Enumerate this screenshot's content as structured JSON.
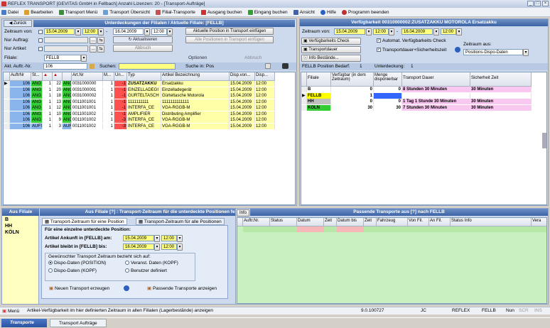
{
  "window": {
    "title": "REFLEX TRANSPORT [GEVITAS GmbH in Fellbach] Anzahl Lizenzen: 20 - [Transport-Aufträge]"
  },
  "menu": [
    {
      "label": "Datei"
    },
    {
      "label": "Bearbeiten"
    },
    {
      "label": "Transport Menü"
    },
    {
      "label": "Transport Übersicht"
    },
    {
      "label": "Filial-Transporte"
    },
    {
      "label": "Ausgang buchen"
    },
    {
      "label": "Eingang buchen"
    },
    {
      "label": "Ansicht"
    },
    {
      "label": "Hilfe"
    },
    {
      "label": "Programm beenden"
    }
  ],
  "left": {
    "back": "Zurück",
    "header": "Unterdeckungen der Filialen / Aktuelle Filiale: [FELLB]",
    "zeitraum_label": "Zeitraum von:",
    "date_from": "15.04.2009",
    "time_from": "12:00",
    "date_to": "16.04.2009",
    "time_to": "12:00",
    "nur_auftrag": "Nur Auftrag:",
    "nur_artikel": "Nur Artikel:",
    "filiale_label": "Filiale:",
    "filiale": "FELLB",
    "btn_insert": "Aktuelle Position in Transport einfügen",
    "btn_insert_all": "Alle Positionen in Transport einfügen",
    "btn_refresh": "Aktualisieren",
    "btn_cancel": "Abbruch",
    "optionen": "Optionen",
    "abbruch": "Abbruch",
    "akt_auftr": "Akt. Auftr.-Nr.",
    "akt_auftr_value": "106",
    "suchen": "Suchen:",
    "suche_in": "Suche in: Pos",
    "columns": [
      "AuftrNr",
      "St...",
      "",
      "",
      "Art.Nr",
      "M...",
      "Un...",
      "Typ",
      "Artikel Bezeichnung",
      "Disp.von...",
      "Disp..."
    ],
    "rows": [
      [
        "106",
        "ANG",
        "1",
        "22",
        "ANG",
        "0031000000",
        "1",
        "-1",
        "ZUSATZAKKU",
        "Ersatzakku",
        "15.04.2009",
        "12:00"
      ],
      [
        "106",
        "ANG",
        "1",
        "20",
        "ANG",
        "0031000001",
        "1",
        "-1",
        "EINZELLADEGI",
        "Einzelladegerät",
        "15.04.2009",
        "12:00"
      ],
      [
        "106",
        "ANG",
        "1",
        "18",
        "ANG",
        "0031000002",
        "1",
        "-1",
        "GÜRTELTASCH",
        "Gürteltasche Motorola",
        "15.04.2009",
        "12:00"
      ],
      [
        "106",
        "ANG",
        "1",
        "13",
        "ANG",
        "0011001001",
        "1",
        "-1",
        "1111111111",
        "1111111111111",
        "15.04.2009",
        "12:00"
      ],
      [
        "106",
        "ANG",
        "1",
        "12",
        "ANG",
        "0011001001",
        "1",
        "-1",
        "INTERFA_CE",
        "VGA-RGGB-M",
        "15.04.2009",
        "12:00"
      ],
      [
        "106",
        "ANG",
        "1",
        "10",
        "ANG",
        "0011001002",
        "1",
        "-1",
        "AMPLIFIER",
        "Distributing Amplifier",
        "15.04.2009",
        "12:00"
      ],
      [
        "106",
        "ANG",
        "1",
        "9",
        "ANG",
        "0011001002",
        "1",
        "-3",
        "INTERFA_CE",
        "VGA-RGGB-M",
        "15.04.2009",
        "12:00"
      ],
      [
        "106",
        "AUFT",
        "1",
        "3",
        "AUFT",
        "0011001002",
        "1",
        "-3",
        "INTERFA_CE",
        "VGA-RGGB-M",
        "15.04.2009",
        "12:00"
      ]
    ]
  },
  "right": {
    "header": "Verfügbarkeit 00310000002:ZUSATZAKKU MOTOROLA Ersatzakku",
    "zeitraum_label": "Zeitraum von:",
    "date_from": "15.04.2009",
    "time_from": "12:00",
    "date_to": "16.04.2009",
    "time_to": "12:00",
    "btn_check": "Verfügbarkeits Check",
    "btn_dauer": "Transportdauer",
    "btn_info": "Info Bestände...",
    "cb_auto": "Automat. Verfügbarkeits Check",
    "cb_sicher": "Transportdauer+Sicherheitszeit",
    "zeitraum_aus_label": "Zeitraum aus:",
    "zeitraum_aus": "Positions-Dispo-Daten",
    "pos_bedarf": "FELLB Position Bedarf:",
    "pos_bedarf_value": "1",
    "unterdeckung": "Unterdeckung:",
    "unterdeckung_value": "1",
    "columns": [
      "Filiale",
      "Verfügbar (in dem Zeitraum)",
      "Menge disponierbar",
      "Transport Dauer",
      "Sicherheit Zeit"
    ],
    "rows": [
      {
        "filiale": "B",
        "verf": "0",
        "menge": "0",
        "dauer": "8 Stunden 30 Minuten",
        "sicher": "30 Minuten",
        "color": "#ffffff"
      },
      {
        "filiale": "FELLB",
        "verf": "1",
        "menge": "",
        "dauer": "",
        "sicher": "",
        "color": "#ffff00"
      },
      {
        "filiale": "HH",
        "verf": "0",
        "menge": "0",
        "dauer": "1 Tag 1 Stunde 30 Minuten",
        "sicher": "30 Minuten",
        "color": "#c0c0c0"
      },
      {
        "filiale": "KÖLN",
        "verf": "30",
        "menge": "30",
        "dauer": "7 Stunden 30 Minuten",
        "sicher": "30 Minuten",
        "color": "#33cc33"
      }
    ]
  },
  "bottom_left": {
    "aus_filiale": "Aus Filiale",
    "list": [
      "B",
      "HH",
      "KÖLN"
    ],
    "header": "Aus Filiale [?] : Transport-Zeitraum für die unterdeckte Positionen festlegen",
    "tab1": "Transport-Zeitraum für eine Position",
    "tab2": "Transport-Zeitraum für alle Positionen",
    "group_title": "Für eine einzelne unterdeckte Position:",
    "ankunft_label": "Artikel Ankunft in [FELLB] am:",
    "ankunft_date": "15.04.2009",
    "ankunft_time": "12:00",
    "bleibt_label": "Artikel bleibt in [FELLB] bis:",
    "bleibt_date": "16.04.2009",
    "bleibt_time": "12:00",
    "bezieht_title": "Gewünschter Transport Zeitraum bezieht sich auf:",
    "r1": "Dispo-Daten (POSITION)",
    "r2": "Veranst. Daten (KOPF)",
    "r3": "Dispo-Daten (KOPF)",
    "r4": "Benutzer definiert",
    "btn_new": "Neuen Transport erzeugen",
    "btn_show": "Passende Transporte anzeigen"
  },
  "bottom_right": {
    "info": "Info",
    "header": "Passende Transporte aus [?] nach FELLB",
    "columns": [
      "Auftr.Nr.",
      "Status",
      "Datum",
      "Zeit",
      "Datum bis",
      "Zeit",
      "Fahrzeug",
      "Von Fil.",
      "An Fil.",
      "Status Info",
      "Vera"
    ]
  },
  "status": {
    "menu": "Menü",
    "text": "Artikel-Verfügbarkeit im hier definierten Zeitraum in allen Filialen (Lagerbestände) anzeigen",
    "version": "9.0.100727",
    "jc": "JC",
    "app": "REFLEX",
    "filiale": "FELLB",
    "nun": "Nun",
    "scr": "SCR",
    "ins": "INS"
  },
  "taskbar": {
    "t1": "Transporte",
    "t2": "Transport Aufträge"
  }
}
